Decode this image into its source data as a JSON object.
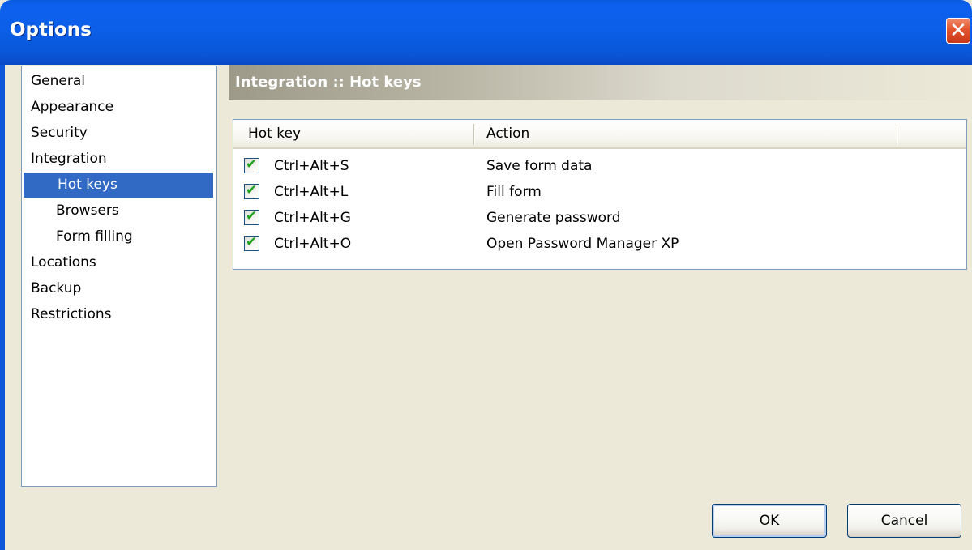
{
  "window": {
    "title": "Options",
    "close_glyph": "✕"
  },
  "nav": {
    "items": [
      {
        "label": "General",
        "child": false,
        "selected": false
      },
      {
        "label": "Appearance",
        "child": false,
        "selected": false
      },
      {
        "label": "Security",
        "child": false,
        "selected": false
      },
      {
        "label": "Integration",
        "child": false,
        "selected": false
      },
      {
        "label": "Hot keys",
        "child": true,
        "selected": true
      },
      {
        "label": "Browsers",
        "child": true,
        "selected": false
      },
      {
        "label": "Form filling",
        "child": true,
        "selected": false
      },
      {
        "label": "Locations",
        "child": false,
        "selected": false
      },
      {
        "label": "Backup",
        "child": false,
        "selected": false
      },
      {
        "label": "Restrictions",
        "child": false,
        "selected": false
      }
    ]
  },
  "panel": {
    "header": "Integration :: Hot keys"
  },
  "table": {
    "columns": [
      "Hot key",
      "Action"
    ],
    "rows": [
      {
        "checked": true,
        "key": "Ctrl+Alt+S",
        "action": "Save form data"
      },
      {
        "checked": true,
        "key": "Ctrl+Alt+L",
        "action": "Fill form"
      },
      {
        "checked": true,
        "key": "Ctrl+Alt+G",
        "action": "Generate password"
      },
      {
        "checked": true,
        "key": "Ctrl+Alt+O",
        "action": "Open Password Manager XP"
      }
    ]
  },
  "buttons": {
    "ok": "OK",
    "cancel": "Cancel"
  },
  "icons": {
    "check": "✔",
    "close": "close-icon"
  },
  "colors": {
    "title_bar": "#0b5fe8",
    "selection": "#316ac5",
    "check": "#21a121",
    "dialog_bg": "#ece9d8"
  }
}
